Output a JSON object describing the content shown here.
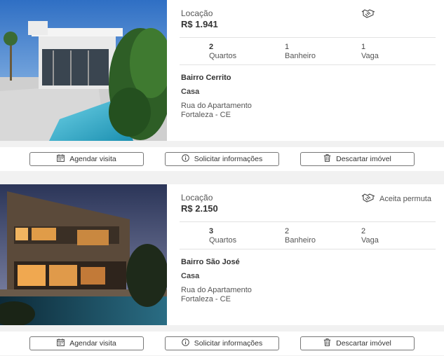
{
  "listings": [
    {
      "type_label": "Locação",
      "price": "R$ 1.941",
      "permuta_label": "",
      "rooms": {
        "count": "2",
        "label": "Quartos"
      },
      "baths": {
        "count": "1",
        "label": "Banheiro"
      },
      "parking": {
        "count": "1",
        "label": "Vaga"
      },
      "neighborhood": "Bairro Cerrito",
      "property_type": "Casa",
      "address_line1": "Rua do Apartamento",
      "address_line2": "Fortaleza - CE"
    },
    {
      "type_label": "Locação",
      "price": "R$ 2.150",
      "permuta_label": "Aceita permuta",
      "rooms": {
        "count": "3",
        "label": "Quartos"
      },
      "baths": {
        "count": "2",
        "label": "Banheiro"
      },
      "parking": {
        "count": "2",
        "label": "Vaga"
      },
      "neighborhood": "Bairro São José",
      "property_type": "Casa",
      "address_line1": "Rua do Apartamento",
      "address_line2": "Fortaleza - CE"
    }
  ],
  "actions": {
    "schedule": "Agendar visita",
    "info": "Solicitar informações",
    "discard": "Descartar imóvel"
  },
  "colors": {
    "pool": "#3fb6d0",
    "border": "#777777",
    "background": "#f1f1f1"
  }
}
